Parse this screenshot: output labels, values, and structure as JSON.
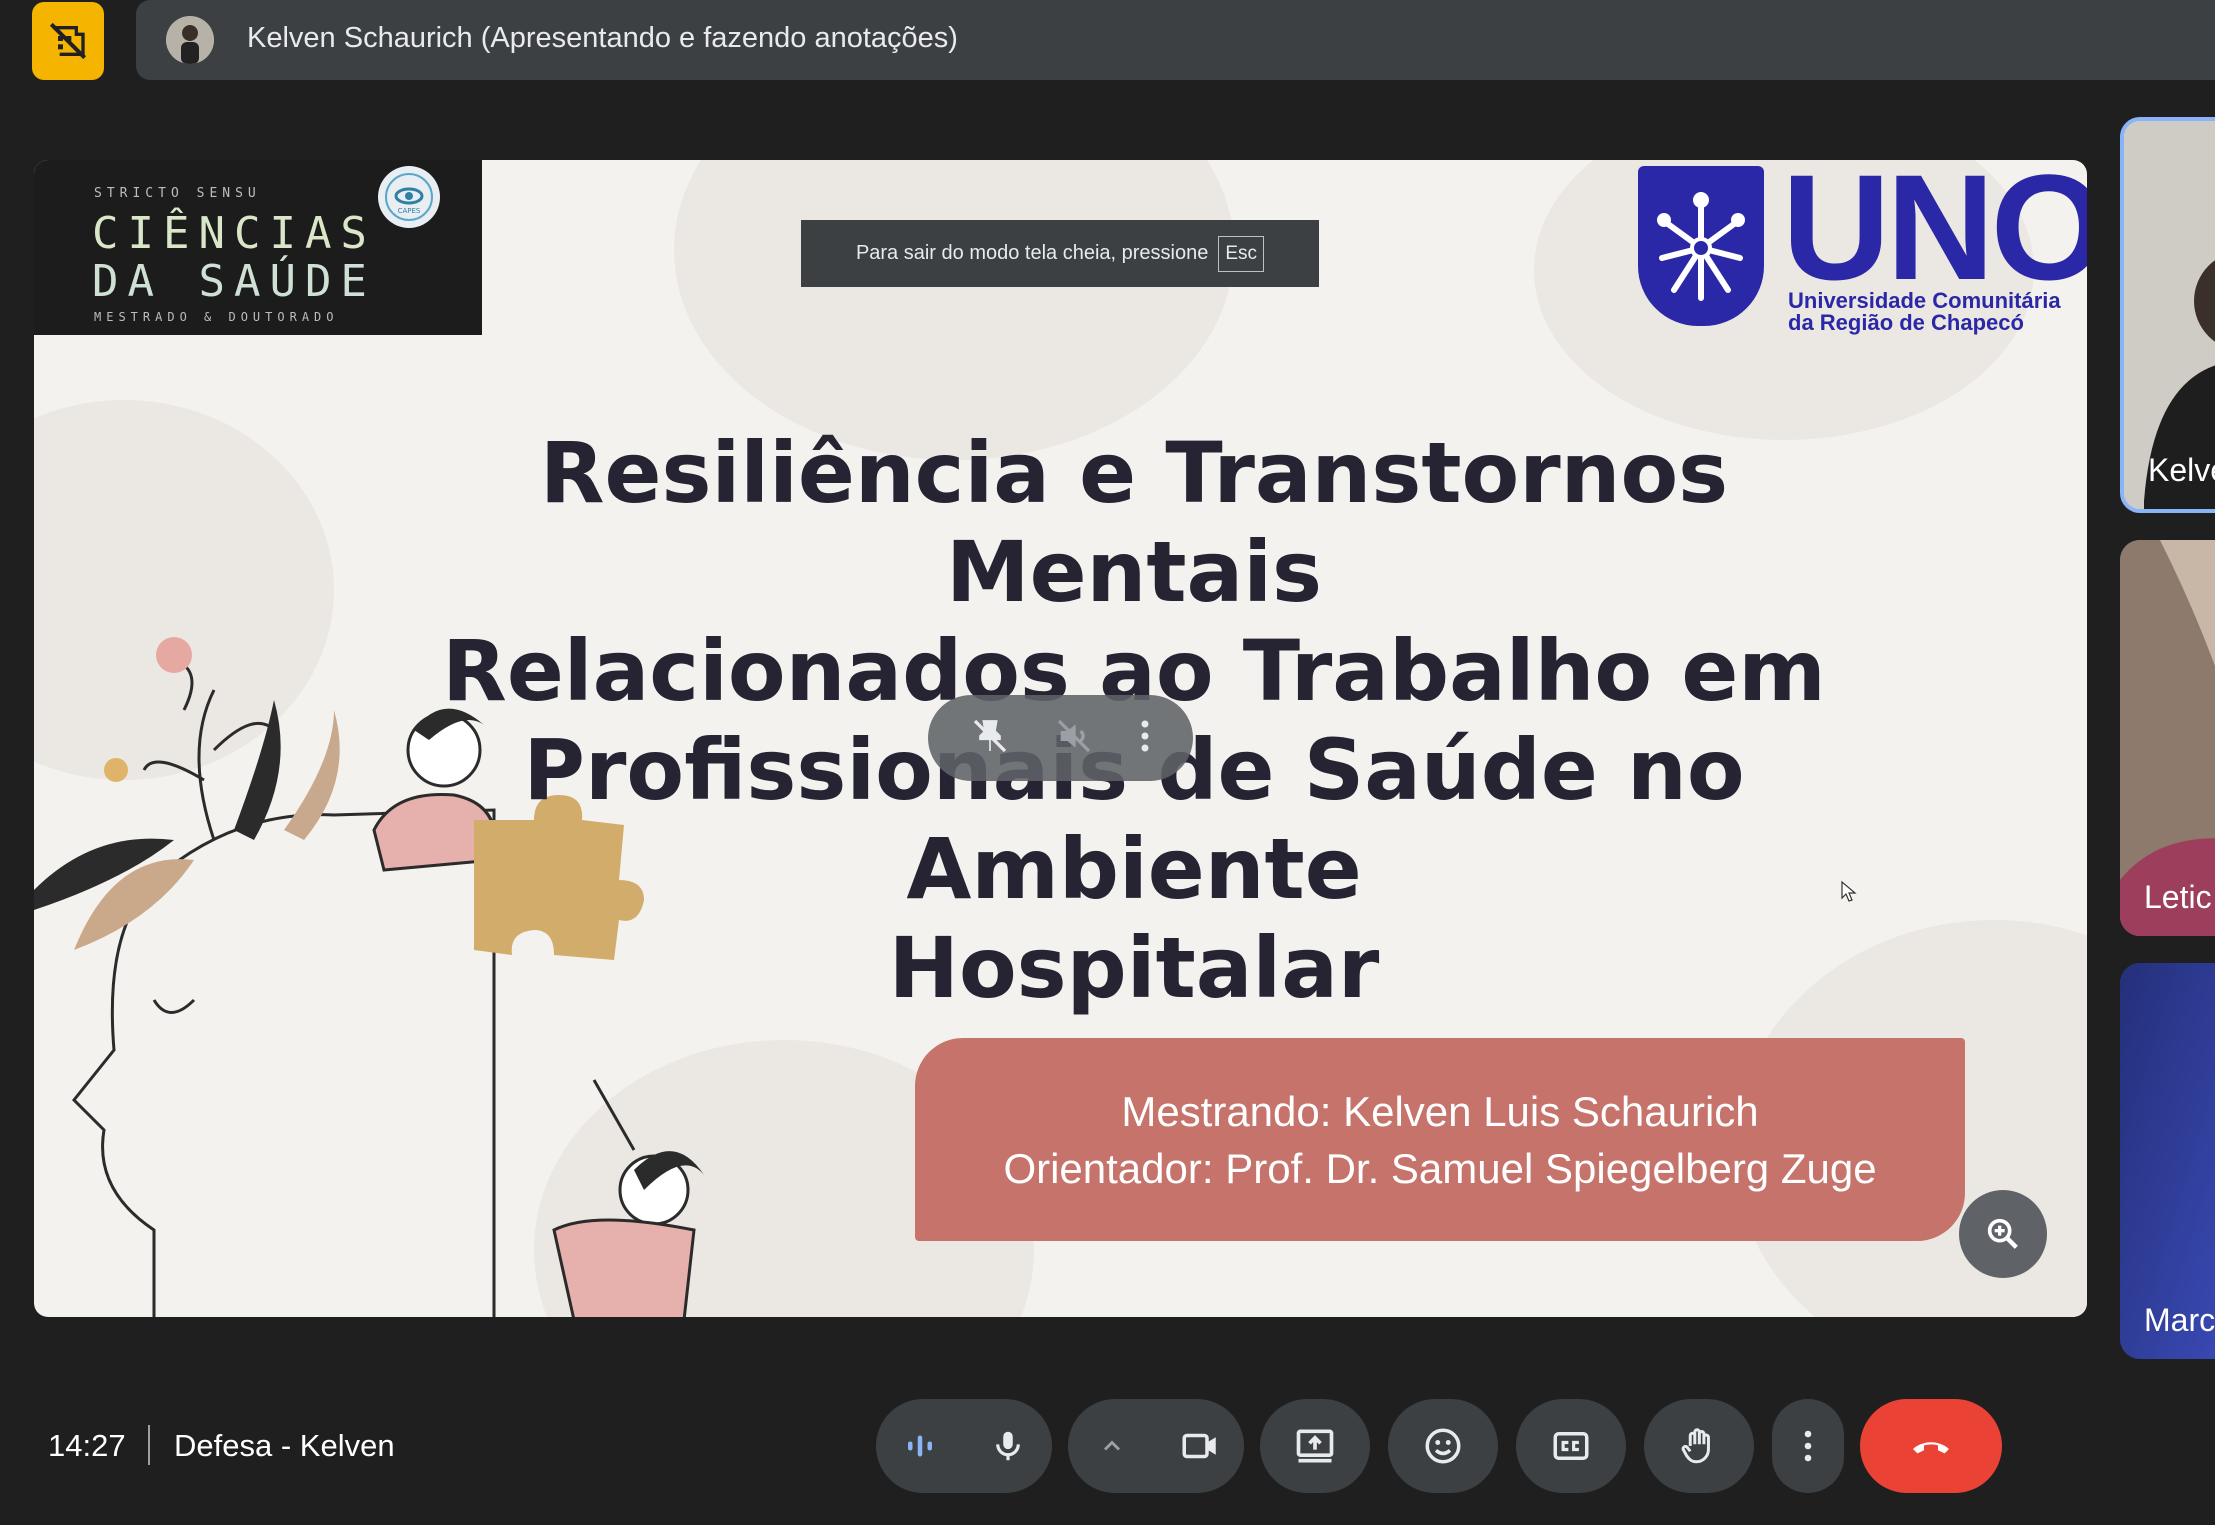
{
  "topbar": {
    "presenter_text": "Kelven Schaurich (Apresentando e fazendo anotações)",
    "no_recording_icon": "recording-off-icon"
  },
  "slide": {
    "logo_left": {
      "small_text": "STRICTO SENSU",
      "line1": "CIÊNCIAS",
      "line2": "DA SAÚDE",
      "footer": "MESTRADO & DOUTORADO",
      "seal_text": "CAPES"
    },
    "logo_right": {
      "word": "UNO",
      "subtitle_line1": "Universidade Comunitária",
      "subtitle_line2": "da Região de Chapecó"
    },
    "title_lines": [
      "Resiliência e Transtornos Mentais",
      "Relacionados ao Trabalho em",
      "Profissionais de Saúde no Ambiente",
      "Hospitalar"
    ],
    "credits_line1": "Mestrando: Kelven Luis Schaurich",
    "credits_line2": "Orientador: Prof. Dr. Samuel Spiegelberg Zuge"
  },
  "fullscreen_toast": {
    "text": "Para sair do modo tela cheia, pressione",
    "key": "Esc"
  },
  "participants": [
    {
      "name": "Kelve"
    },
    {
      "name": "Letic"
    },
    {
      "name": "Marc"
    }
  ],
  "bottombar": {
    "time": "14:27",
    "meeting_name": "Defesa - Kelven"
  },
  "colors": {
    "accent_blue": "#8ab4f8",
    "end_call_red": "#ea4335",
    "no_record_yellow": "#f4b400",
    "uno_blue": "#2b28a8",
    "credits_box": "#c5736b"
  }
}
